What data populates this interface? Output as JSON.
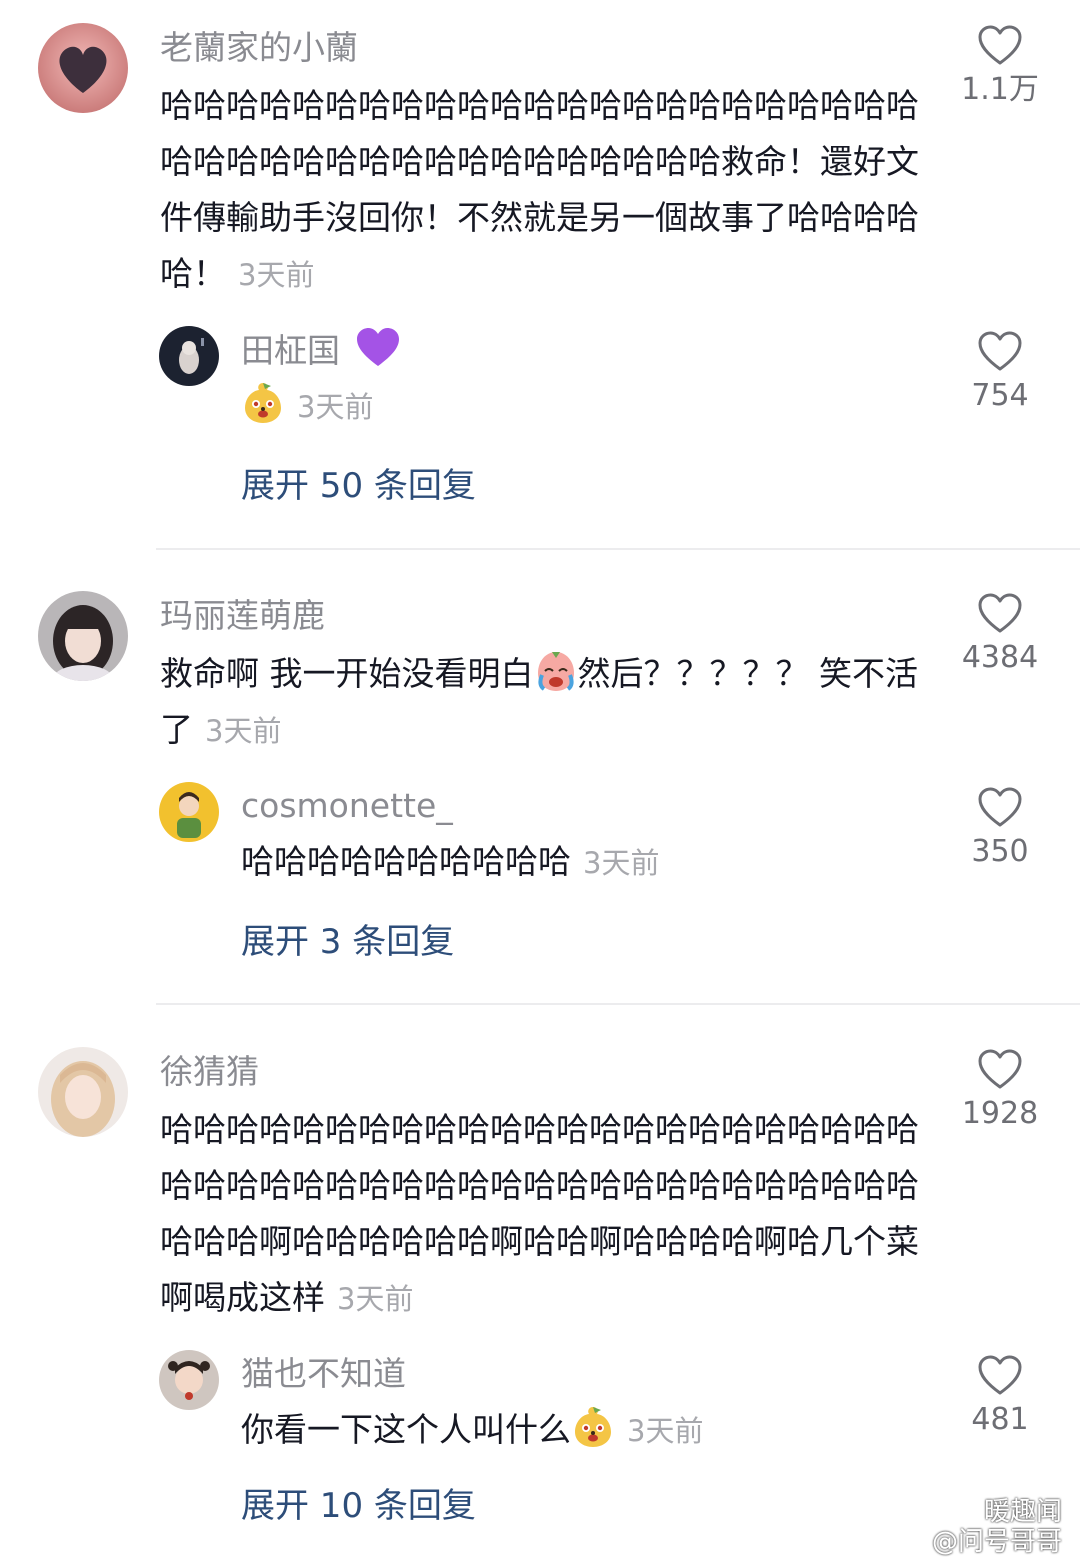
{
  "comments": [
    {
      "username": "老蘭家的小蘭",
      "text": "哈哈哈哈哈哈哈哈哈哈哈哈哈哈哈哈哈哈哈哈哈哈哈哈哈哈哈哈哈哈哈哈哈哈哈哈哈哈哈哈救命！還好文件傳輸助手沒回你！不然就是另一個故事了哈哈哈哈哈！",
      "time": "3天前",
      "likes": "1.1万",
      "reply": {
        "username": "田柾国",
        "username_emoji": "purple-heart",
        "text": "",
        "emoji": "mango-pup-emoji",
        "time": "3天前",
        "likes": "754"
      },
      "expand": "展开 50 条回复"
    },
    {
      "username": "玛丽莲萌鹿",
      "text_before_emoji": "救命啊 我一开始没看明白",
      "text_after_emoji": "然后？？？？？ 笑不活了",
      "emoji": "crying-face-emoji",
      "time": "3天前",
      "likes": "4384",
      "reply": {
        "username": "cosmonette_",
        "text": "哈哈哈哈哈哈哈哈哈哈",
        "time": "3天前",
        "likes": "350"
      },
      "expand": "展开 3 条回复"
    },
    {
      "username": "徐猜猜",
      "text": "哈哈哈哈哈哈哈哈哈哈哈哈哈哈哈哈哈哈哈哈哈哈哈哈哈哈哈哈哈哈哈哈哈哈哈哈哈哈哈哈哈哈哈哈哈哈哈哈哈啊哈哈哈哈哈哈啊哈哈啊哈哈哈哈啊哈几个菜啊喝成这样",
      "time": "3天前",
      "likes": "1928",
      "reply": {
        "username": "猫也不知道",
        "text": "你看一下这个人叫什么",
        "emoji": "mango-pup-emoji",
        "time": "3天前",
        "likes": "481"
      },
      "expand": "展开 10 条回复"
    }
  ],
  "watermark": {
    "line1": "暖趣闻",
    "line2": "@问号哥哥"
  },
  "colors": {
    "username": "#8a8b91",
    "body": "#161823",
    "time": "#a7a8ad",
    "expand_link": "#2d4d79",
    "like_count": "#6d6e74",
    "divider": "#ececee"
  }
}
